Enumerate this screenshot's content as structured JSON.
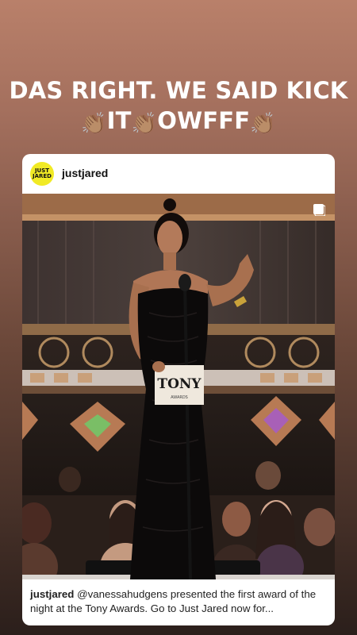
{
  "story": {
    "caption_line1": "DAS RIGHT. WE SAID KICK",
    "caption_word_it": "IT",
    "caption_word_owfff": "OWFFF",
    "clap_emoji": "👏🏽"
  },
  "post": {
    "avatar_line1": "JUST",
    "avatar_line2": "JARED",
    "username": "justjared",
    "photo_sign_title": "TONY",
    "photo_sign_sub": "AWARDS",
    "caption_user": "justjared",
    "caption_text": "@vanessahudgens presented the first award of the night at the Tony Awards. Go to Just Jared now for..."
  },
  "colors": {
    "avatar_bg": "#f1ea25",
    "story_bg_top": "#b9806a",
    "story_bg_bottom": "#2b1f1b"
  }
}
